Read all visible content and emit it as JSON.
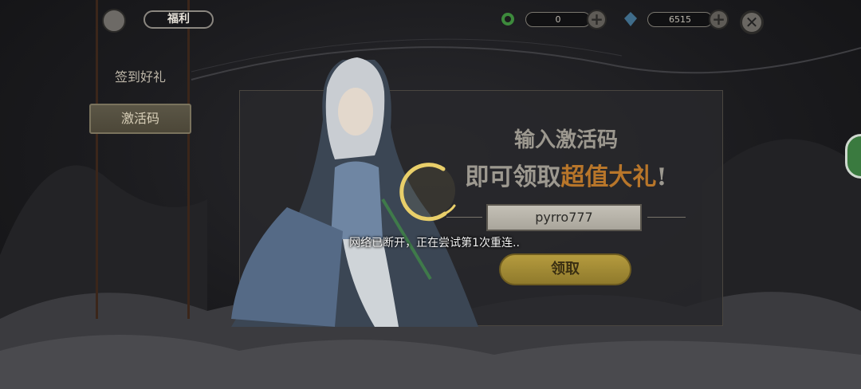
{
  "header": {
    "title": "福利",
    "resources": [
      {
        "icon": "green-swirl-gem-icon",
        "value": "0"
      },
      {
        "icon": "blue-crystal-icon",
        "value": "6515"
      }
    ],
    "close_label": "✕"
  },
  "sidebar": {
    "items": [
      {
        "label": "签到好礼",
        "active": false
      },
      {
        "label": "激活码",
        "active": true
      }
    ]
  },
  "panel": {
    "heading": "输入激活码",
    "subtitle_prefix": "即可领取",
    "subtitle_highlight": "超值大礼",
    "subtitle_suffix": "!",
    "code_value": "pyrro777",
    "claim_label": "领取"
  },
  "toast": {
    "message": "网络已断开，正在尝试第1次重连.."
  },
  "colors": {
    "highlight": "#b8762a",
    "subtitle": "#9d9990",
    "claim_button": "#a88f37"
  }
}
